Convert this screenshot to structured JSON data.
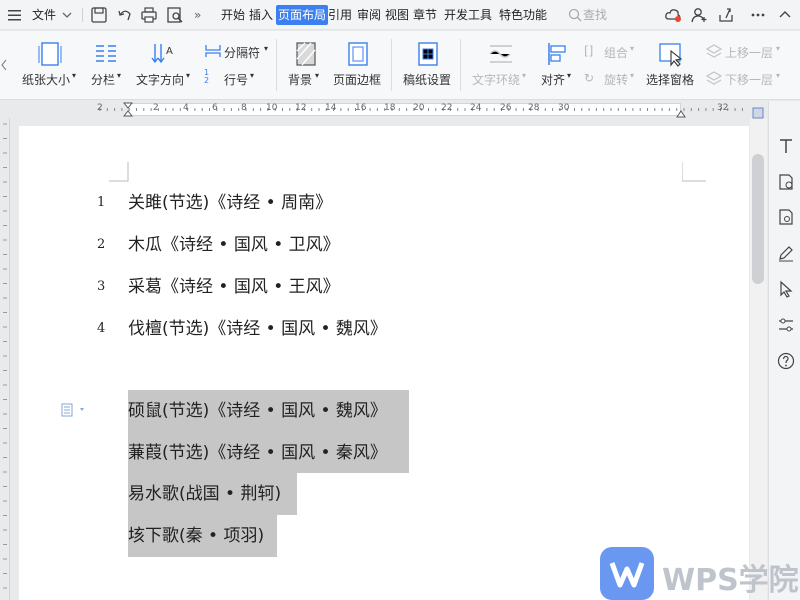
{
  "menubar": {
    "file_label": "文件",
    "tabs": [
      {
        "label": "开始",
        "active": false
      },
      {
        "label": "插入",
        "active": false
      },
      {
        "label": "页面布局",
        "active": true
      },
      {
        "label": "引用",
        "active": false
      },
      {
        "label": "审阅",
        "active": false
      },
      {
        "label": "视图",
        "active": false
      },
      {
        "label": "章节",
        "active": false
      },
      {
        "label": "开发工具",
        "active": false
      },
      {
        "label": "特色功能",
        "active": false
      }
    ],
    "search_label": "查找",
    "overflow": "»"
  },
  "ribbon": {
    "paper_size": "纸张大小",
    "columns": "分栏",
    "text_direction": "文字方向",
    "separator": "分隔符",
    "line_number": "行号",
    "background": "背景",
    "page_border": "页面边框",
    "manuscript": "稿纸设置",
    "text_wrap": "文字环绕",
    "align": "对齐",
    "group": "组合",
    "rotate": "旋转",
    "selection_pane": "选择窗格",
    "bring_forward": "上移一层",
    "send_backward": "下移一层",
    "group_glyph": "[]",
    "rotate_glyph": "↻",
    "line_number_glyph": "1 2"
  },
  "ruler": {
    "ticks": [
      "2",
      "2",
      "4",
      "6",
      "8",
      "10",
      "12",
      "14",
      "16",
      "18",
      "20",
      "22",
      "24",
      "26",
      "28",
      "30",
      "32"
    ]
  },
  "document": {
    "numbered_lines": [
      {
        "num": "1",
        "text": "关雎(节选)《诗经 • 周南》"
      },
      {
        "num": "2",
        "text": "木瓜《诗经 • 国风 • 卫风》"
      },
      {
        "num": "3",
        "text": "采葛《诗经 • 国风 • 王风》"
      },
      {
        "num": "4",
        "text": "伐檀(节选)《诗经 • 国风 • 魏风》"
      }
    ],
    "selected_lines": [
      "硕鼠(节选)《诗经 • 国风 • 魏风》",
      "蒹葭(节选)《诗经 • 国风 • 秦风》",
      "易水歌(战国 • 荆轲)",
      "垓下歌(秦 • 项羽)"
    ]
  },
  "watermark": {
    "text": "WPS学院"
  },
  "colors": {
    "accent": "#3b7ff0",
    "selection": "#c6c6c6",
    "wps_logo": "#5a8df0"
  }
}
